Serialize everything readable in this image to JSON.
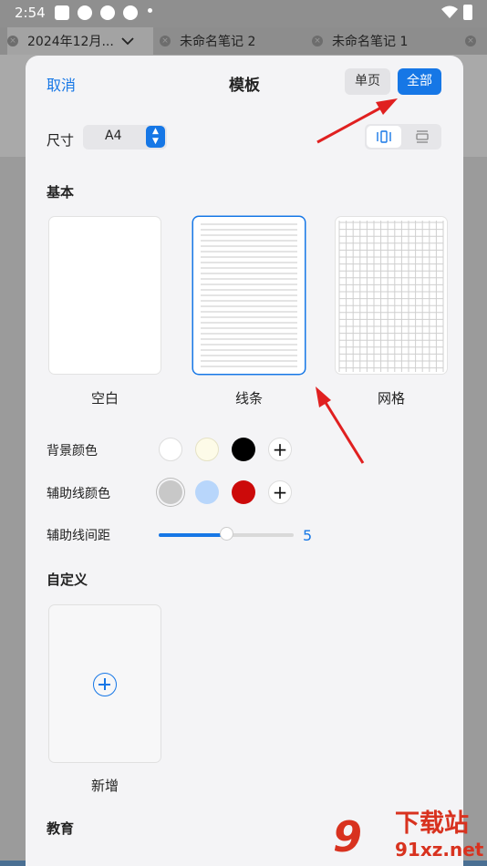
{
  "status": {
    "time": "2:54"
  },
  "tabs": [
    {
      "label": "2024年12月..."
    },
    {
      "label": "未命名笔记 2"
    },
    {
      "label": "未命名笔记 1"
    }
  ],
  "dialog": {
    "cancel_label": "取消",
    "title": "模板",
    "single_label": "单页",
    "all_label": "全部",
    "size_label": "尺寸",
    "size_value": "A4",
    "orientation": {
      "portrait": "|○|",
      "landscape": "□"
    },
    "basic_section": "基本",
    "templates": [
      {
        "label": "空白",
        "selected": false
      },
      {
        "label": "线条",
        "selected": true
      },
      {
        "label": "网格",
        "selected": false
      }
    ],
    "bg_color_label": "背景颜色",
    "bg_colors": [
      "#ffffff",
      "#fdfbe8",
      "#000000"
    ],
    "guide_color_label": "辅助线颜色",
    "guide_colors": [
      "#c8c8c8",
      "#b8d6fb",
      "#cc0a0a"
    ],
    "add_symbol": "+",
    "spacing_label": "辅助线间距",
    "spacing_value": "5",
    "spacing_fraction": 0.5,
    "custom_section": "自定义",
    "new_label": "新增",
    "education_section": "教育"
  },
  "watermark": {
    "logo": "9",
    "text": "下载站",
    "url": "91xz.net"
  },
  "colors": {
    "accent": "#1677e6",
    "annotation_arrow": "#e02020"
  }
}
